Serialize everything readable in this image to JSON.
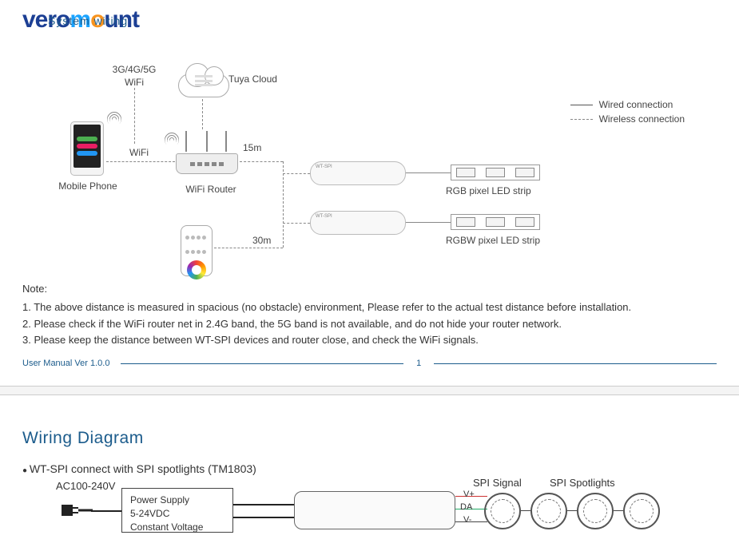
{
  "heading_text": "System wiring",
  "logo": {
    "p1": "vero",
    "p2": "m",
    "p3": "o",
    "p4": "unt"
  },
  "diagram": {
    "wifi_3g": "3G/4G/5G",
    "wifi_label": "WiFi",
    "tuya": "Tuya Cloud",
    "mobile": "Mobile Phone",
    "router": "WiFi Router",
    "dist15": "15m",
    "dist30": "30m",
    "rgb_strip": "RGB pixel LED strip",
    "rgbw_strip": "RGBW pixel LED strip",
    "ctrl_model": "WT-SPI"
  },
  "legend": {
    "wired": "Wired connection",
    "wireless": "Wireless connection"
  },
  "notes": {
    "title": "Note:",
    "n1": "1. The above distance is measured in spacious (no obstacle) environment, Please refer to the actual test distance before installation.",
    "n2": "2. Please check if the WiFi router net in 2.4G band, the 5G band is not available, and do not hide your router network.",
    "n3": "3. Please keep the distance between WT-SPI devices and router close, and check the WiFi signals."
  },
  "footer": {
    "version": "User Manual Ver 1.0.0",
    "page": "1"
  },
  "wiring": {
    "title": "Wiring Diagram",
    "sub": "WT-SPI connect with SPI spotlights (TM1803)",
    "ac": "AC100-240V",
    "psu_l1": "Power Supply",
    "psu_l2": "5-24VDC",
    "psu_l3": "Constant Voltage",
    "spi_signal": "SPI Signal",
    "spi_spotlights": "SPI Spotlights",
    "vplus": "V+",
    "da": "DA",
    "vminus": "V-"
  }
}
